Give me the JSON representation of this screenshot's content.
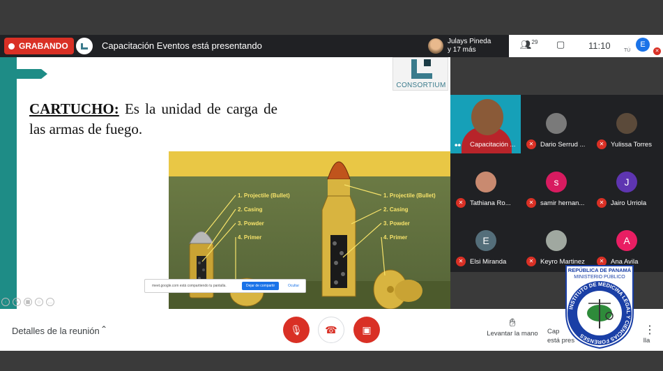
{
  "topbar": {
    "recording_label": "GRABANDO",
    "presenting_text": "Capacitación Eventos está presentando",
    "participants_line1": "Julays Pineda",
    "participants_line2": "y 17 más",
    "people_count": "29",
    "clock": "11:10",
    "self_initial": "E",
    "self_label": "TÚ"
  },
  "slide": {
    "logo_text": "CONSORTIUM",
    "keyword": "CARTUCHO:",
    "sentence": " Es la unidad de carga de las armas de fuego.",
    "labels_left": [
      "1. Projectile (Bullet)",
      "2. Casing",
      "3. Powder",
      "4. Primer"
    ],
    "labels_right": [
      "1. Projectile (Bullet)",
      "2. Casing",
      "3. Powder",
      "4. Primer"
    ],
    "share_text": "meet.google.com está compartiendo tu pantalla.",
    "share_button": "Dejar de compartir",
    "hide_button": "Ocultar"
  },
  "participants": [
    {
      "name": "Capacitación ...",
      "initial": "",
      "color": "",
      "video": true
    },
    {
      "name": "Dario Serrud ...",
      "initial": "",
      "color": "#7a7a7a"
    },
    {
      "name": "Yulissa Torres",
      "initial": "",
      "color": "#5b4a3a"
    },
    {
      "name": "Tathiana Ro...",
      "initial": "",
      "color": "#c98a70"
    },
    {
      "name": "samir hernan...",
      "initial": "s",
      "color": "#d81b60"
    },
    {
      "name": "Jairo Urriola",
      "initial": "J",
      "color": "#5e35b1"
    },
    {
      "name": "Elsi Miranda",
      "initial": "E",
      "color": "#546e7a"
    },
    {
      "name": "Keyro Martinez",
      "initial": "",
      "color": "#a0a8a0"
    },
    {
      "name": "Ana Avila",
      "initial": "A",
      "color": "#e91e63"
    }
  ],
  "bottombar": {
    "details_label": "Detalles de la reunión",
    "raise_hand_label": "Levantar la mano",
    "present_label_1": "Cap",
    "present_label_2": "está pres",
    "present_label_3": "lla"
  },
  "seal": {
    "top_line_1": "REPÚBLICA DE PANAMÁ",
    "top_line_2": "MINISTERIO PÚBLICO",
    "ring_text": "INSTITUTO DE MEDICINA LEGAL Y CIENCIAS FORENSES"
  },
  "colors": {
    "record_red": "#d93025",
    "teal": "#1e8c86",
    "meet_blue": "#1a73e8",
    "seal_blue": "#1a3fa6"
  }
}
